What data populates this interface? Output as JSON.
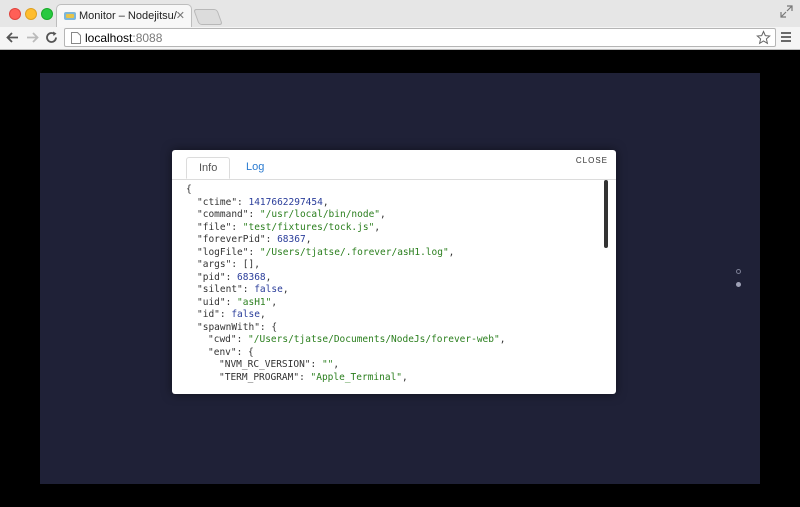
{
  "browser": {
    "tab_title": "Monitor – Nodejitsu/forever",
    "tab_close": "✕",
    "url_host": "localhost",
    "url_port": ":8088"
  },
  "modal": {
    "tabs": [
      {
        "label": "Info",
        "active": true
      },
      {
        "label": "Log",
        "active": false
      }
    ],
    "close_label": "CLOSE",
    "json_lines": [
      {
        "indent": 0,
        "parts": [
          {
            "t": "k",
            "v": "{"
          }
        ]
      },
      {
        "indent": 1,
        "parts": [
          {
            "t": "k",
            "v": "\"ctime\": "
          },
          {
            "t": "n",
            "v": "1417662297454"
          },
          {
            "t": "k",
            "v": ","
          }
        ]
      },
      {
        "indent": 1,
        "parts": [
          {
            "t": "k",
            "v": "\"command\": "
          },
          {
            "t": "s",
            "v": "\"/usr/local/bin/node\""
          },
          {
            "t": "k",
            "v": ","
          }
        ]
      },
      {
        "indent": 1,
        "parts": [
          {
            "t": "k",
            "v": "\"file\": "
          },
          {
            "t": "s",
            "v": "\"test/fixtures/tock.js\""
          },
          {
            "t": "k",
            "v": ","
          }
        ]
      },
      {
        "indent": 1,
        "parts": [
          {
            "t": "k",
            "v": "\"foreverPid\": "
          },
          {
            "t": "n",
            "v": "68367"
          },
          {
            "t": "k",
            "v": ","
          }
        ]
      },
      {
        "indent": 1,
        "parts": [
          {
            "t": "k",
            "v": "\"logFile\": "
          },
          {
            "t": "s",
            "v": "\"/Users/tjatse/.forever/asH1.log\""
          },
          {
            "t": "k",
            "v": ","
          }
        ]
      },
      {
        "indent": 1,
        "parts": [
          {
            "t": "k",
            "v": "\"args\": [],"
          }
        ]
      },
      {
        "indent": 1,
        "parts": [
          {
            "t": "k",
            "v": "\"pid\": "
          },
          {
            "t": "n",
            "v": "68368"
          },
          {
            "t": "k",
            "v": ","
          }
        ]
      },
      {
        "indent": 1,
        "parts": [
          {
            "t": "k",
            "v": "\"silent\": "
          },
          {
            "t": "n",
            "v": "false"
          },
          {
            "t": "k",
            "v": ","
          }
        ]
      },
      {
        "indent": 1,
        "parts": [
          {
            "t": "k",
            "v": "\"uid\": "
          },
          {
            "t": "s",
            "v": "\"asH1\""
          },
          {
            "t": "k",
            "v": ","
          }
        ]
      },
      {
        "indent": 1,
        "parts": [
          {
            "t": "k",
            "v": "\"id\": "
          },
          {
            "t": "n",
            "v": "false"
          },
          {
            "t": "k",
            "v": ","
          }
        ]
      },
      {
        "indent": 1,
        "parts": [
          {
            "t": "k",
            "v": "\"spawnWith\": {"
          }
        ]
      },
      {
        "indent": 2,
        "parts": [
          {
            "t": "k",
            "v": "\"cwd\": "
          },
          {
            "t": "s",
            "v": "\"/Users/tjatse/Documents/NodeJs/forever-web\""
          },
          {
            "t": "k",
            "v": ","
          }
        ]
      },
      {
        "indent": 2,
        "parts": [
          {
            "t": "k",
            "v": "\"env\": {"
          }
        ]
      },
      {
        "indent": 3,
        "parts": [
          {
            "t": "k",
            "v": "\"NVM_RC_VERSION\": "
          },
          {
            "t": "s",
            "v": "\"\""
          },
          {
            "t": "k",
            "v": ","
          }
        ]
      },
      {
        "indent": 3,
        "parts": [
          {
            "t": "k",
            "v": "\"TERM_PROGRAM\": "
          },
          {
            "t": "s",
            "v": "\"Apple_Terminal\""
          },
          {
            "t": "k",
            "v": ","
          }
        ]
      }
    ]
  },
  "colors": {
    "page_bg": "#1f2137",
    "string": "#2b7f1e",
    "number": "#2a3d9a",
    "tab_link": "#2b7bd0"
  }
}
